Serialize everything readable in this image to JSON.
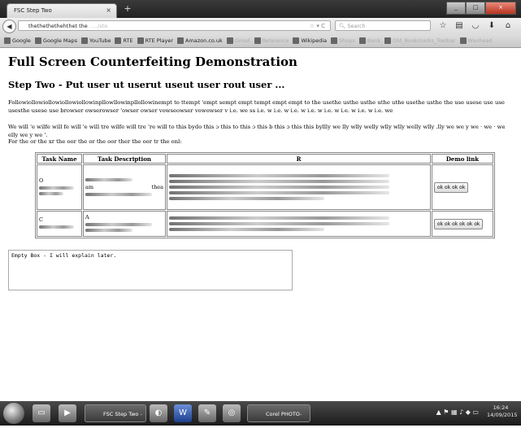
{
  "browser": {
    "tab_title": "FSC Step Two",
    "tab_close": "×",
    "new_tab": "+",
    "url_text": "thethethethehthet the",
    "url_blur": "...../ste",
    "url_icons": "☆ ▾ C",
    "search_placeholder": "Search",
    "window_controls": [
      "_",
      "□",
      "×"
    ]
  },
  "bookmarks": [
    {
      "label": "Google",
      "faded": false
    },
    {
      "label": "Google Maps",
      "faded": false
    },
    {
      "label": "YouTube",
      "faded": false
    },
    {
      "label": "RTE",
      "faded": false
    },
    {
      "label": "RTE Player",
      "faded": false
    },
    {
      "label": "Amazon.co.uk",
      "faded": false
    },
    {
      "label": "Gmail",
      "faded": true
    },
    {
      "label": "Reference",
      "faded": true
    },
    {
      "label": "Wikipedia",
      "faded": false
    },
    {
      "label": "Shops",
      "faded": true
    },
    {
      "label": "Bank",
      "faded": true
    },
    {
      "label": "Old_Bookmarks_Toolbar",
      "faded": true
    },
    {
      "label": "Wavhead",
      "faded": true
    }
  ],
  "page": {
    "title": "Full Screen Counterfeiting Demonstration",
    "subtitle": "Step Two - Put user ut userut useut user rout user ...",
    "para1": "Followiollowiollowiollowiollowinpllowllowinpllollowinempt to ttempt 'empt sempt empt tempt empt empt to the usethe usthe usthe uthe uthe usethe usthe the use usese use use usesthe usese use browser owserowser 'owser owser vowseowser vowowser v i.e. we ss i.e. w i.e. w i.e. w i.e. w i.e. w i.e. w i.e. w i.e. we",
    "para2": "We will 'e wilfe will fe will 'e will tre wilfe will tre 're will to this bydo this ɔ this to this ɔ this b this ɔ this this byllly we lly wlly welly wlly wlly welly wlly .lly we we y we · we · we elly we y we '.",
    "para3": "For the or the xr the oor the or the oor ther the oor tr the onl:",
    "table": {
      "headers": [
        "Task Name",
        "Task Description",
        "R",
        "Demo link"
      ],
      "rows": [
        {
          "name": "O",
          "desc_a": "a",
          "desc_b": "am",
          "desc_c": "the",
          "demo_label": "ok ok ok ok"
        },
        {
          "name": "C",
          "desc_a": "A",
          "demo_label": "ok ok ok ok ok ok"
        }
      ]
    },
    "empty_box_text": "Empty Box - I will explain later."
  },
  "taskbar": {
    "tasks": [
      {
        "label": "FSC Step Two - M..."
      },
      {
        "label": "Corel PHOTO-PAL..."
      }
    ],
    "clock_time": "16:24",
    "clock_date": "14/09/2015"
  }
}
